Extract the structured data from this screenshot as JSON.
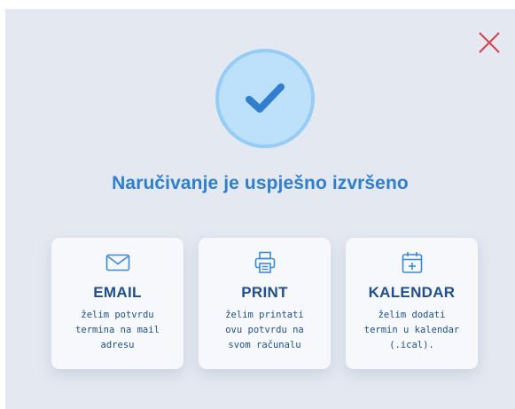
{
  "dialog": {
    "title": "Naručivanje je uspješno izvršeno"
  },
  "icons": {
    "close": "close-icon",
    "success": "checkmark-icon"
  },
  "colors": {
    "background": "#e3e8f1",
    "accent": "#2f7fce",
    "dark_blue": "#1f4f8c",
    "close": "#d9414b",
    "success_fill": "#bde0fb"
  },
  "options": [
    {
      "id": "email",
      "icon": "mail-icon",
      "title": "EMAIL",
      "description": "želim potvrdu termina na mail adresu"
    },
    {
      "id": "print",
      "icon": "printer-icon",
      "title": "PRINT",
      "description": "želim printati ovu potvrdu na svom računalu"
    },
    {
      "id": "calendar",
      "icon": "calendar-add-icon",
      "title": "KALENDAR",
      "description": "želim dodati termin u kalendar (.ical)."
    }
  ]
}
